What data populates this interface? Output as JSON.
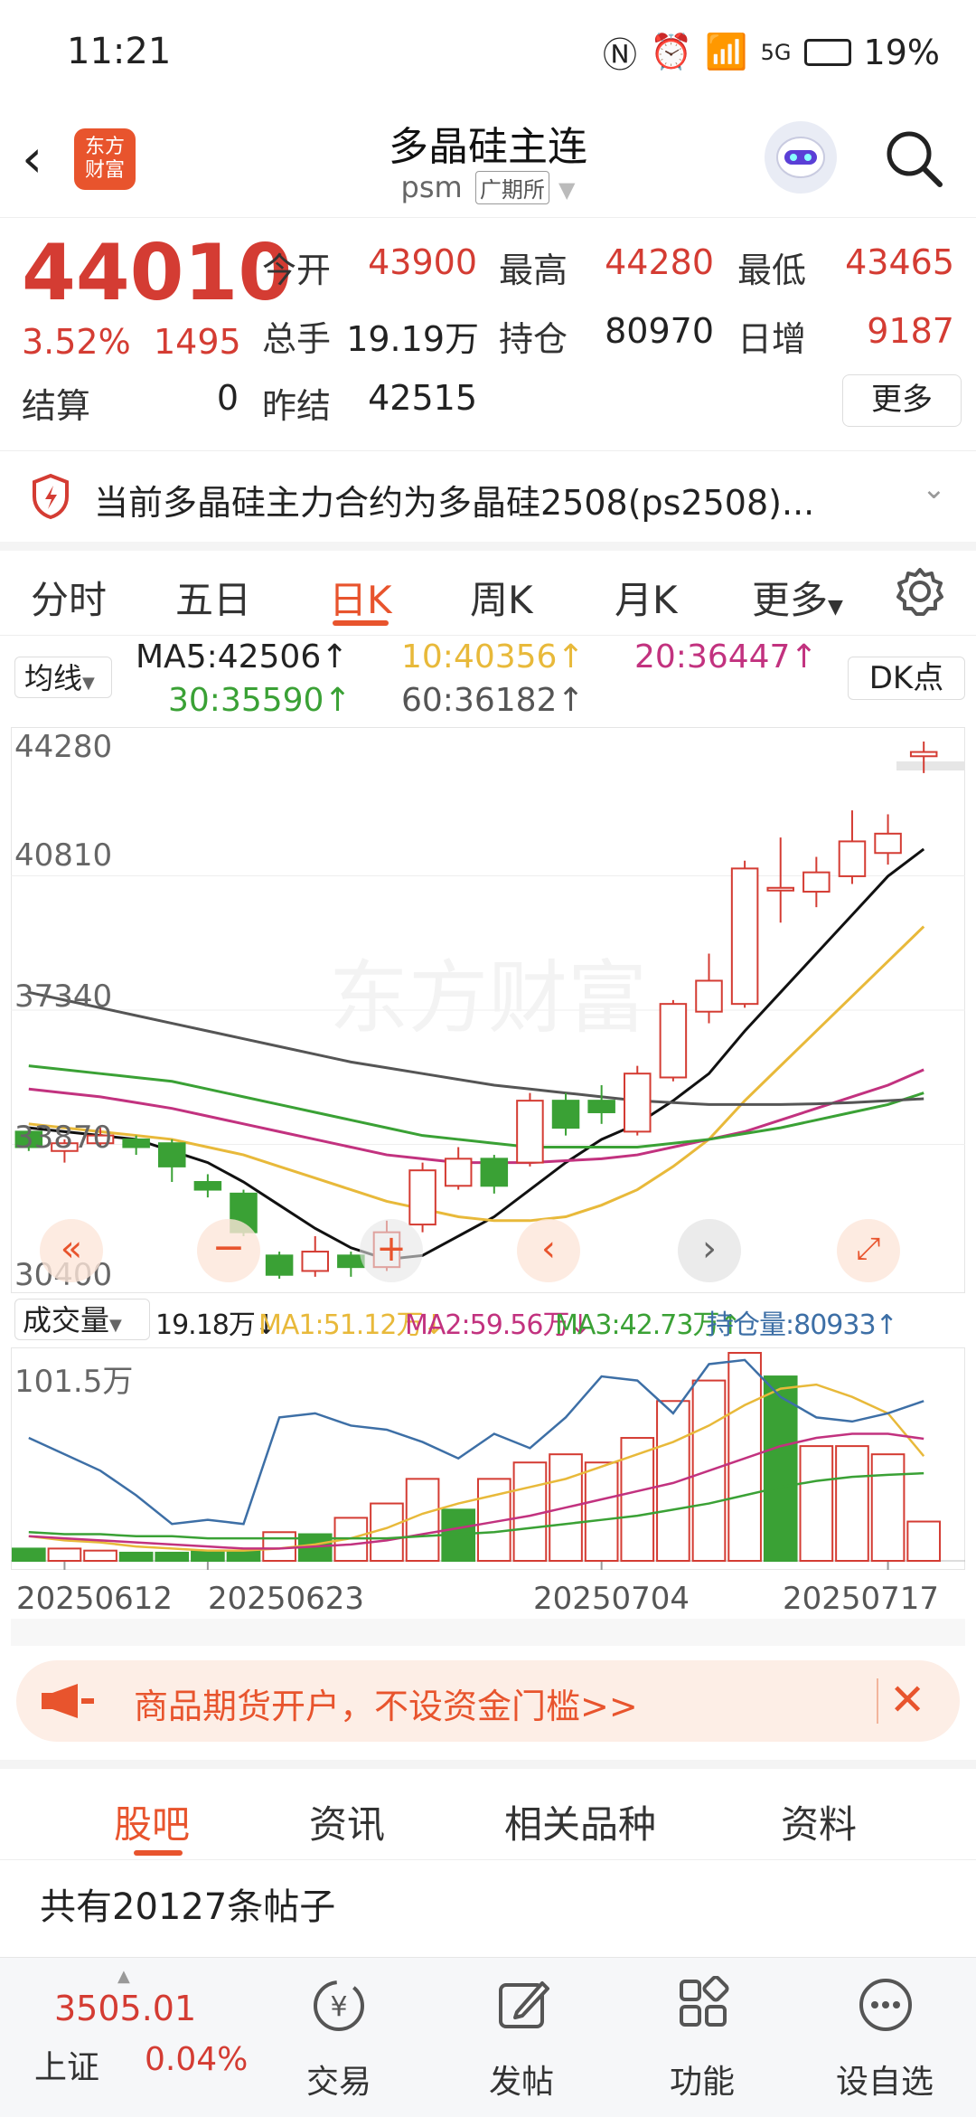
{
  "status": {
    "time": "11:21",
    "battery": "19%",
    "network": "5G"
  },
  "header": {
    "back_icon": "chevron-left-icon",
    "logo_line1": "东方",
    "logo_line2": "财富",
    "title": "多晶硅主连",
    "code": "psm",
    "exchange": "广期所"
  },
  "quote": {
    "price": "44010",
    "pct": "3.52%",
    "change": "1495",
    "open_label": "今开",
    "open": "43900",
    "high_label": "最高",
    "high": "44280",
    "low_label": "最低",
    "low": "43465",
    "volume_label": "总手",
    "volume": "19.19万",
    "oi_label": "持仓",
    "oi": "80970",
    "daily_inc_label": "日增",
    "daily_inc": "9187",
    "settle_label": "结算",
    "settle": "0",
    "prev_settle_label": "昨结",
    "prev_settle": "42515",
    "more": "更多"
  },
  "notice": {
    "text": "当前多晶硅主力合约为多晶硅2508(ps2508)..."
  },
  "tabs": [
    "分时",
    "五日",
    "日K",
    "周K",
    "月K",
    "更多"
  ],
  "ma": {
    "selector": "均线",
    "ma5": "MA5:42506↑",
    "ma10": "10:40356↑",
    "ma20": "20:36447↑",
    "ma30": "30:35590↑",
    "ma60": "60:36182↑",
    "dk": "DK点"
  },
  "colors": {
    "up": "#d43c33",
    "down": "#3aa135",
    "accent": "#e8542d"
  },
  "chart_data": [
    {
      "type": "candlestick",
      "title": "",
      "y_ticks": [
        "44280",
        "40810",
        "37340",
        "33870",
        "30400"
      ],
      "ylim": [
        30400,
        44280
      ],
      "x_ticks": [
        "20250612",
        "20250623",
        "20250704",
        "20250717"
      ],
      "candles": [
        {
          "o": 34200,
          "c": 33800,
          "h": 34300,
          "l": 33700
        },
        {
          "o": 33700,
          "c": 33900,
          "h": 34000,
          "l": 33400
        },
        {
          "o": 33900,
          "c": 34100,
          "h": 34300,
          "l": 33800
        },
        {
          "o": 34000,
          "c": 33800,
          "h": 34100,
          "l": 33600
        },
        {
          "o": 33900,
          "c": 33300,
          "h": 34000,
          "l": 32900
        },
        {
          "o": 32900,
          "c": 32700,
          "h": 33100,
          "l": 32500
        },
        {
          "o": 32600,
          "c": 31600,
          "h": 32700,
          "l": 31500
        },
        {
          "o": 31000,
          "c": 30500,
          "h": 31100,
          "l": 30400
        },
        {
          "o": 30600,
          "c": 31100,
          "h": 31500,
          "l": 30450
        },
        {
          "o": 31000,
          "c": 30700,
          "h": 31100,
          "l": 30450
        },
        {
          "o": 30700,
          "c": 31600,
          "h": 31900,
          "l": 30600
        },
        {
          "o": 31800,
          "c": 33200,
          "h": 33400,
          "l": 31600
        },
        {
          "o": 32800,
          "c": 33500,
          "h": 33800,
          "l": 32700
        },
        {
          "o": 33500,
          "c": 32800,
          "h": 33600,
          "l": 32600
        },
        {
          "o": 33400,
          "c": 35000,
          "h": 35200,
          "l": 33300
        },
        {
          "o": 35000,
          "c": 34300,
          "h": 35200,
          "l": 34100
        },
        {
          "o": 35000,
          "c": 34700,
          "h": 35400,
          "l": 34400
        },
        {
          "o": 34200,
          "c": 35700,
          "h": 35900,
          "l": 34100
        },
        {
          "o": 35600,
          "c": 37500,
          "h": 37600,
          "l": 35500
        },
        {
          "o": 37300,
          "c": 38100,
          "h": 38800,
          "l": 37000
        },
        {
          "o": 37500,
          "c": 41000,
          "h": 41200,
          "l": 37400
        },
        {
          "o": 40500,
          "c": 40500,
          "h": 41800,
          "l": 39600
        },
        {
          "o": 40400,
          "c": 40900,
          "h": 41300,
          "l": 40000
        },
        {
          "o": 40800,
          "c": 41700,
          "h": 42500,
          "l": 40600
        },
        {
          "o": 41400,
          "c": 41900,
          "h": 42400,
          "l": 41100
        },
        {
          "o": 43900,
          "c": 44010,
          "h": 44280,
          "l": 43465
        }
      ],
      "ma_lines": {
        "MA5": [
          34300,
          34200,
          34100,
          34000,
          33700,
          33400,
          32900,
          32300,
          31700,
          31200,
          30900,
          31000,
          31500,
          32000,
          32700,
          33400,
          34000,
          34400,
          35000,
          35700,
          36800,
          37800,
          38800,
          39800,
          40800,
          41500
        ],
        "MA10": [
          34400,
          34300,
          34200,
          34100,
          34000,
          33800,
          33600,
          33300,
          33000,
          32700,
          32400,
          32200,
          32000,
          31900,
          31900,
          32000,
          32300,
          32700,
          33300,
          34000,
          35000,
          35900,
          36800,
          37700,
          38600,
          39500
        ],
        "MA20": [
          35300,
          35200,
          35100,
          34950,
          34800,
          34600,
          34400,
          34200,
          34000,
          33800,
          33600,
          33500,
          33400,
          33400,
          33400,
          33450,
          33500,
          33600,
          33800,
          34000,
          34200,
          34500,
          34800,
          35100,
          35400,
          35800
        ],
        "MA30": [
          35900,
          35800,
          35700,
          35600,
          35500,
          35300,
          35100,
          34900,
          34700,
          34500,
          34300,
          34100,
          34000,
          33900,
          33800,
          33800,
          33800,
          33800,
          33900,
          34000,
          34150,
          34300,
          34500,
          34700,
          34900,
          35200
        ],
        "MA60": [
          37800,
          37600,
          37400,
          37200,
          37000,
          36800,
          36600,
          36400,
          36200,
          36000,
          35850,
          35700,
          35550,
          35400,
          35300,
          35200,
          35100,
          35000,
          34950,
          34900,
          34900,
          34900,
          34920,
          34950,
          35000,
          35050
        ]
      }
    },
    {
      "type": "bar",
      "title": "",
      "selector": "成交量",
      "legend": {
        "vol": "19.18万↓",
        "ma1": "MA1:51.12万↓",
        "ma2": "MA2:59.56万↓",
        "ma3": "MA3:42.73万↑",
        "oi": "持仓量:80933↑"
      },
      "y_top_label": "101.5万",
      "ylim": [
        0,
        101.5
      ],
      "volumes": [
        6,
        6,
        5,
        4,
        4,
        5,
        5,
        14,
        13,
        21,
        28,
        40,
        25,
        40,
        48,
        52,
        48,
        60,
        78,
        88,
        101.5,
        90,
        56,
        56,
        52,
        19.18
      ],
      "down": [
        true,
        false,
        false,
        true,
        true,
        true,
        true,
        false,
        true,
        false,
        false,
        false,
        true,
        false,
        false,
        false,
        false,
        false,
        false,
        false,
        false,
        true,
        false,
        false,
        false,
        false
      ],
      "ma1": [
        12,
        10,
        9,
        7,
        6,
        5,
        5,
        6,
        8,
        11,
        16,
        23,
        28,
        32,
        36,
        40,
        46,
        52,
        58,
        66,
        76,
        84,
        86,
        80,
        72,
        51.12
      ],
      "ma2": [
        12,
        11,
        10,
        9,
        8,
        7,
        6,
        6,
        7,
        8,
        10,
        13,
        16,
        19,
        22,
        26,
        30,
        34,
        38,
        44,
        50,
        56,
        60,
        62,
        62,
        59.56
      ],
      "ma3": [
        14,
        13,
        13,
        12,
        12,
        11,
        11,
        11,
        11,
        11,
        11,
        12,
        13,
        14,
        16,
        18,
        20,
        22,
        25,
        28,
        32,
        36,
        39,
        41,
        42,
        42.73
      ],
      "oi_line": [
        60,
        52,
        44,
        32,
        18,
        20,
        18,
        70,
        72,
        66,
        64,
        58,
        50,
        62,
        55,
        70,
        90,
        88,
        72,
        96,
        98,
        80,
        70,
        68,
        72,
        78
      ]
    }
  ],
  "banner": {
    "text": "商品期货开户，不设资金门槛>>"
  },
  "bottom_tabs": [
    "股吧",
    "资讯",
    "相关品种",
    "资料"
  ],
  "posts": {
    "count_text": "共有20127条帖子"
  },
  "bottom_nav": {
    "index_value": "3505.01",
    "index_name": "上证",
    "index_pct": "0.04%",
    "items": [
      "交易",
      "发帖",
      "功能",
      "设自选"
    ]
  }
}
